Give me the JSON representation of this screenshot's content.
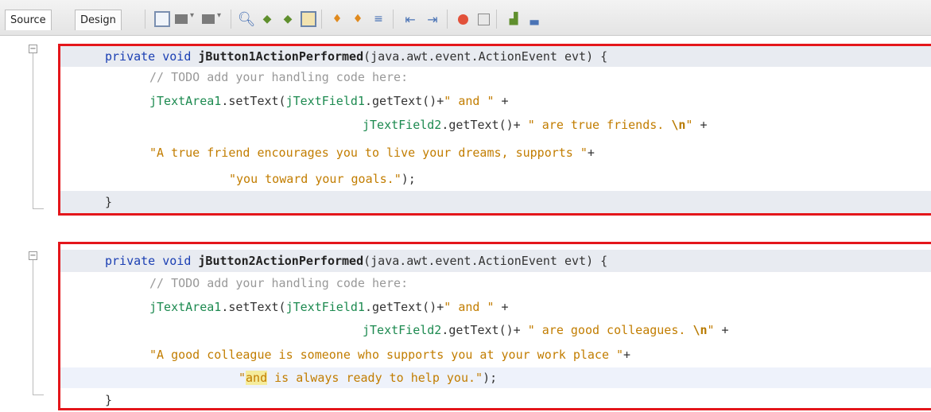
{
  "toolbar": {
    "tabs": [
      {
        "label": "Source"
      },
      {
        "label": "Design"
      }
    ],
    "icons": [
      "last-edit-icon",
      "back-icon",
      "forward-icon",
      "find-icon",
      "find-previous-icon",
      "find-next-icon",
      "toggle-highlight-icon",
      "previous-bookmark-icon",
      "next-bookmark-icon",
      "toggle-bookmark-icon",
      "shift-left-icon",
      "shift-right-icon",
      "start-macro-icon",
      "stop-macro-icon",
      "comment-icon",
      "uncomment-icon"
    ]
  },
  "colors": {
    "highlight_box": "#e4161b",
    "keyword": "#1b3fb3",
    "string": "#c27d00",
    "field": "#1d8a50",
    "comment": "#999999"
  },
  "code": {
    "method1": {
      "modifier": "private",
      "return_type": "void",
      "name": "jButton1ActionPerformed",
      "params": "(java.awt.event.ActionEvent evt) {",
      "comment": "// TODO add your handling code here:",
      "l3_obj": "jTextArea1",
      "l3_call": ".setText(",
      "l3_field": "jTextField1",
      "l3_get": ".getText()+",
      "l3_str": "\" and \"",
      "l3_plus": " +",
      "l4_field": "jTextField2",
      "l4_get": ".getText()+ ",
      "l4_str": "\" are true friends. ",
      "l4_esc": "\\n",
      "l4_str_end": "\"",
      "l4_plus": " +",
      "l5_str": "\"A true friend encourages you to live your dreams, supports \"",
      "l5_plus": "+",
      "l6_str": "\"you toward your goals.\"",
      "l6_end": ");",
      "close": "}"
    },
    "method2": {
      "modifier": "private",
      "return_type": "void",
      "name": "jButton2ActionPerformed",
      "params": "(java.awt.event.ActionEvent evt) {",
      "comment": "// TODO add your handling code here:",
      "l3_obj": "jTextArea1",
      "l3_call": ".setText(",
      "l3_field": "jTextField1",
      "l3_get": ".getText()+",
      "l3_str": "\" and \"",
      "l3_plus": " +",
      "l4_field": "jTextField2",
      "l4_get": ".getText()+ ",
      "l4_str": "\" are good colleagues. ",
      "l4_esc": "\\n",
      "l4_str_end": "\"",
      "l4_plus": " +",
      "l5_str": "\"A good colleague is someone who supports you at your work place \"",
      "l5_plus": "+",
      "l6_str_a": "\"",
      "l6_str_hl": "and",
      "l6_str_b": " is always ready to help you.\"",
      "l6_end": ");",
      "close": "}"
    }
  }
}
